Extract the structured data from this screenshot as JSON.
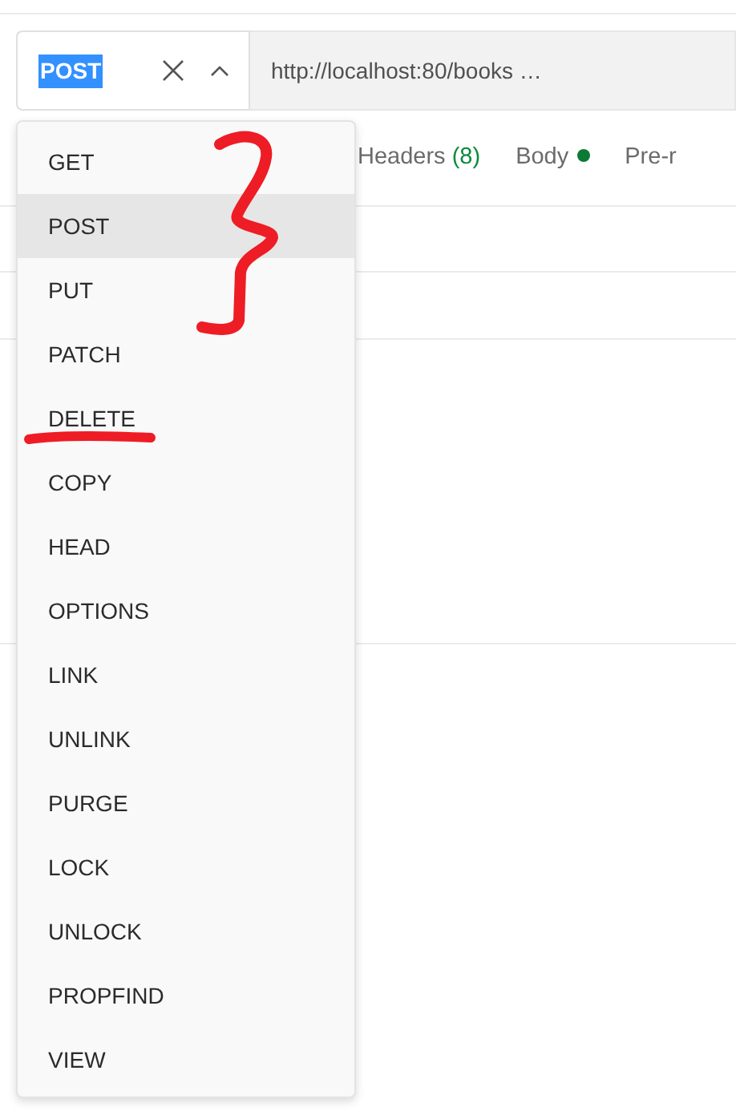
{
  "request": {
    "method": "POST",
    "url": "http://localhost:80/books …"
  },
  "tabs": [
    {
      "label": "Headers",
      "count": "(8)",
      "dot": false
    },
    {
      "label": "Body",
      "dot": true
    },
    {
      "label": "Pre-r",
      "dot": false
    }
  ],
  "method_menu": [
    {
      "label": "GET",
      "selected": false
    },
    {
      "label": "POST",
      "selected": true
    },
    {
      "label": "PUT",
      "selected": false
    },
    {
      "label": "PATCH",
      "selected": false
    },
    {
      "label": "DELETE",
      "selected": false
    },
    {
      "label": "COPY",
      "selected": false
    },
    {
      "label": "HEAD",
      "selected": false
    },
    {
      "label": "OPTIONS",
      "selected": false
    },
    {
      "label": "LINK",
      "selected": false
    },
    {
      "label": "UNLINK",
      "selected": false
    },
    {
      "label": "PURGE",
      "selected": false
    },
    {
      "label": "LOCK",
      "selected": false
    },
    {
      "label": "UNLOCK",
      "selected": false
    },
    {
      "label": "PROPFIND",
      "selected": false
    },
    {
      "label": "VIEW",
      "selected": false
    }
  ]
}
